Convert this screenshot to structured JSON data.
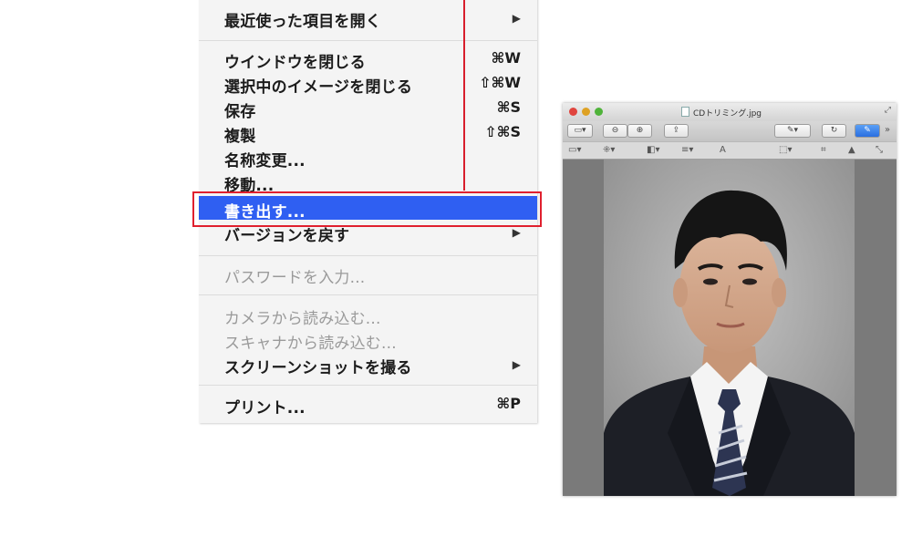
{
  "menu": {
    "items": [
      {
        "label": "最近使った項目を開く",
        "submenu": true
      },
      {
        "label": "ウインドウを閉じる",
        "shortcut": "⌘W"
      },
      {
        "label": "選択中のイメージを閉じる",
        "shortcut": "⇧⌘W"
      },
      {
        "label": "保存",
        "shortcut": "⌘S"
      },
      {
        "label": "複製",
        "shortcut": "⇧⌘S"
      },
      {
        "label": "名称変更..."
      },
      {
        "label": "移動..."
      },
      {
        "label": "書き出す...",
        "selected": true
      },
      {
        "label": "バージョンを戻す",
        "submenu": true
      },
      {
        "label": "パスワードを入力...",
        "disabled": true
      },
      {
        "label": "カメラから読み込む...",
        "disabled": true
      },
      {
        "label": "スキャナから読み込む...",
        "disabled": true
      },
      {
        "label": "スクリーンショットを撮る",
        "submenu": true
      },
      {
        "label": "プリント...",
        "shortcut": "⌘P"
      }
    ],
    "submenu_arrow": "▶",
    "highlight_color": "#2f5ff2",
    "annotation_color": "#e0202e"
  },
  "preview_window": {
    "title": "CDトリミング.jpg",
    "traffic_lights": [
      "#e0443e",
      "#dea123",
      "#4fb33a"
    ]
  }
}
